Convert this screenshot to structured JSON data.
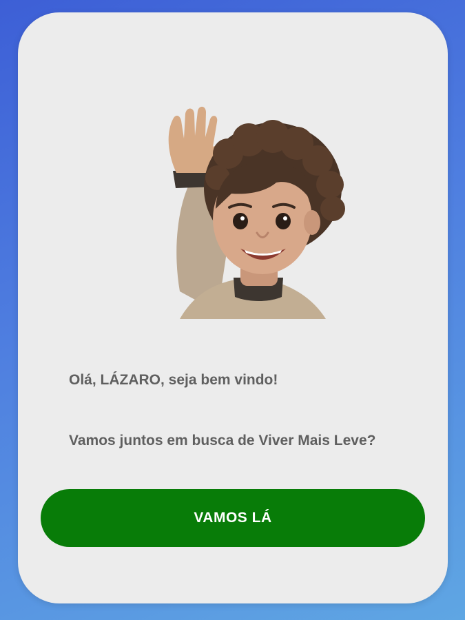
{
  "welcome": {
    "greeting": "Olá, LÁZARO, seja bem vindo!",
    "subtitle": "Vamos juntos em busca de Viver Mais Leve?",
    "cta_label": "VAMOS LÁ",
    "avatar_icon": "waving-memoji-icon"
  },
  "colors": {
    "background_top": "#3d5fd6",
    "background_bottom": "#5fa6e3",
    "card": "#ececec",
    "text": "#5f5f5f",
    "button": "#087c08",
    "button_text": "#ffffff"
  }
}
